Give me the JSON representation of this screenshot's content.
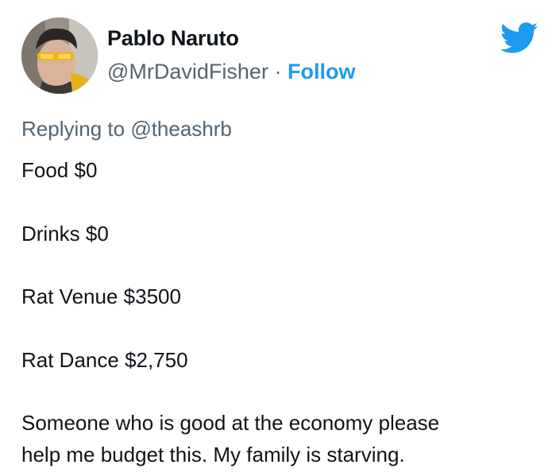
{
  "tweet": {
    "author_name": "Pablo Naruto",
    "handle": "@MrDavidFisher",
    "separator": "·",
    "follow_label": "Follow",
    "replying_prefix": "Replying to",
    "replying_to": "@theashrb",
    "lines": [
      "Food $0",
      "Drinks $0",
      "Rat Venue $3500",
      "Rat Dance $2,750",
      "Someone who is good at the economy please",
      "help me budget this. My family is starving."
    ]
  },
  "colors": {
    "text": "#0f1419",
    "muted": "#536471",
    "accent": "#1d9bf0"
  },
  "icons": {
    "logo": "twitter-bird-icon"
  }
}
